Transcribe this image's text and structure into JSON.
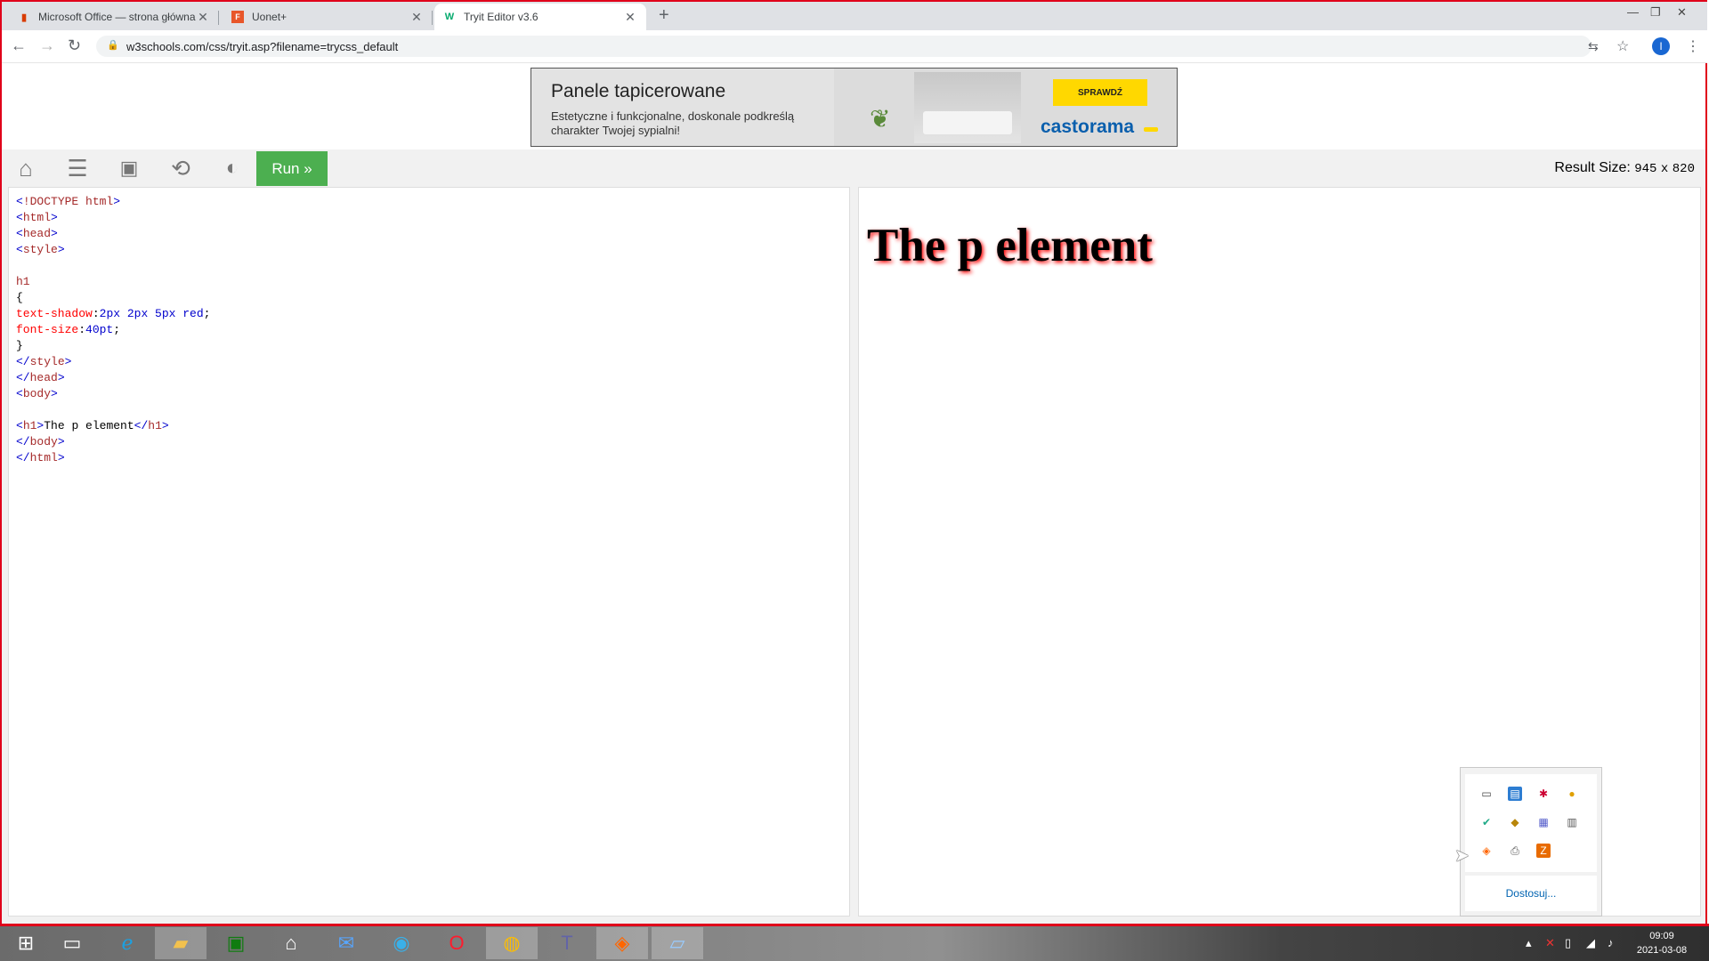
{
  "browser": {
    "tabs": [
      {
        "title": "Microsoft Office — strona główna",
        "favicon": "office-icon",
        "active": false
      },
      {
        "title": "Uonet+",
        "favicon": "uonet-icon",
        "active": false
      },
      {
        "title": "Tryit Editor v3.6",
        "favicon": "w3schools-icon",
        "active": true
      }
    ],
    "new_tab": "+",
    "url": "w3schools.com/css/tryit.asp?filename=trycss_default",
    "profile_initial": "I"
  },
  "ad": {
    "title": "Panele tapicerowane",
    "description": "Estetyczne i funkcjonalne, doskonale podkreślą charakter Twojej sypialni!",
    "cta": "SPRAWDŹ",
    "brand": "castorama"
  },
  "toolbar": {
    "run_label": "Run »",
    "result_size_label": "Result Size:",
    "result_width": "945",
    "result_x": "x",
    "result_height": "820"
  },
  "code_lines": [
    "<!DOCTYPE html>",
    "<html>",
    "<head>",
    "<style>",
    "",
    "h1",
    "{",
    "text-shadow:2px 2px 5px red;",
    "font-size:40pt;",
    "}",
    "</style>",
    "</head>",
    "<body>",
    "",
    "<h1>The p element</h1>",
    "</body>",
    "</html>"
  ],
  "result": {
    "heading": "The p element"
  },
  "tray_popup": {
    "customize_label": "Dostosuj..."
  },
  "taskbar": {
    "time": "09:09",
    "date": "2021-03-08"
  }
}
